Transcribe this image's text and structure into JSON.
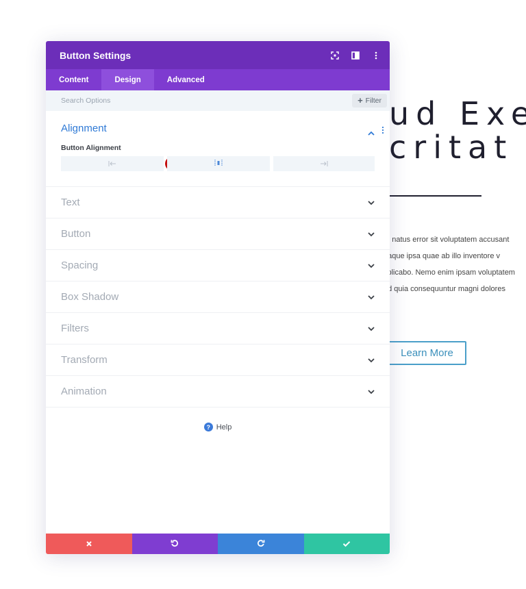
{
  "background_page": {
    "heading_line1": "ud Exe",
    "heading_line2": "critat",
    "paragraph_lines": [
      "te natus error sit voluptatem accusant",
      "eaque ipsa quae ab illo inventore v",
      "xplicabo. Nemo enim ipsam voluptatem",
      "ed quia consequuntur magni dolores"
    ],
    "button_label": "Learn More"
  },
  "modal": {
    "title": "Button Settings",
    "header_icons": [
      "fullscreen-icon",
      "split-view-icon",
      "more-options-icon"
    ],
    "tabs": [
      {
        "label": "Content",
        "active": false
      },
      {
        "label": "Design",
        "active": true
      },
      {
        "label": "Advanced",
        "active": false
      }
    ],
    "search": {
      "placeholder": "Search Options"
    },
    "filter_label": "Filter",
    "open_section": {
      "title": "Alignment",
      "field_label": "Button Alignment",
      "options": [
        "align-left-icon",
        "align-center-icon",
        "align-right-icon"
      ],
      "badge": "1"
    },
    "sections": [
      "Text",
      "Button",
      "Spacing",
      "Box Shadow",
      "Filters",
      "Transform",
      "Animation"
    ],
    "help_label": "Help",
    "footer": [
      "cancel-icon",
      "undo-icon",
      "redo-icon",
      "save-icon"
    ]
  },
  "colors": {
    "header": "#6c2eb9",
    "tabs": "#7e3bd0",
    "active_section": "#2f7ad6",
    "cancel": "#ef5a5a",
    "undo": "#7f3dd1",
    "redo": "#3b84d9",
    "save": "#2fc5a2",
    "badge": "#c30d0d"
  }
}
